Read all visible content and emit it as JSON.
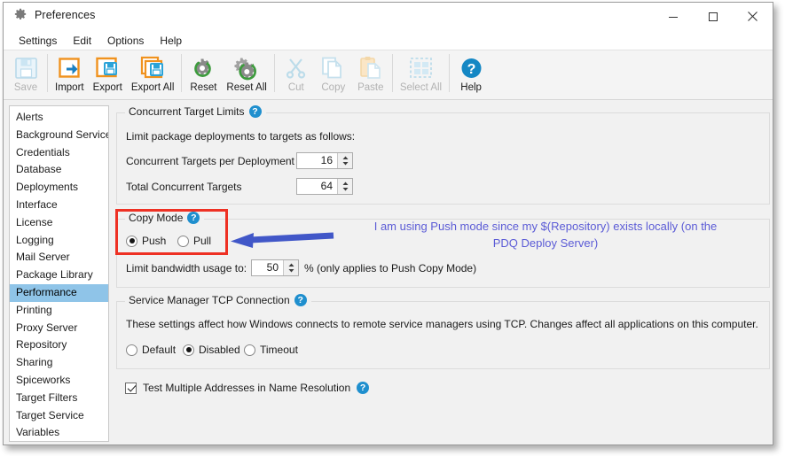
{
  "window": {
    "title": "Preferences",
    "icon": "gear-icon",
    "minimize_label": "–",
    "maximize_label": "❐",
    "close_label": "✕"
  },
  "menubar": {
    "items": [
      {
        "label": "Settings"
      },
      {
        "label": "Edit"
      },
      {
        "label": "Options"
      },
      {
        "label": "Help"
      }
    ]
  },
  "toolbar": {
    "buttons": [
      {
        "label": "Save",
        "icon": "save-floppy-icon",
        "disabled": true
      },
      {
        "label": "Import",
        "icon": "import-icon",
        "disabled": false
      },
      {
        "label": "Export",
        "icon": "export-icon",
        "disabled": false
      },
      {
        "label": "Export All",
        "icon": "export-all-icon",
        "disabled": false
      },
      {
        "label": "Reset",
        "icon": "reset-gear-icon",
        "disabled": false
      },
      {
        "label": "Reset All",
        "icon": "reset-all-gear-icon",
        "disabled": false
      },
      {
        "label": "Cut",
        "icon": "scissors-icon",
        "disabled": true
      },
      {
        "label": "Copy",
        "icon": "copy-pages-icon",
        "disabled": true
      },
      {
        "label": "Paste",
        "icon": "clipboard-paste-icon",
        "disabled": true
      },
      {
        "label": "Select All",
        "icon": "select-all-icon",
        "disabled": true
      },
      {
        "label": "Help",
        "icon": "help-circle-icon",
        "disabled": false
      }
    ]
  },
  "sidebar": {
    "selected": "Performance",
    "items": [
      {
        "label": "Alerts"
      },
      {
        "label": "Background Service"
      },
      {
        "label": "Credentials"
      },
      {
        "label": "Database"
      },
      {
        "label": "Deployments"
      },
      {
        "label": "Interface"
      },
      {
        "label": "License"
      },
      {
        "label": "Logging"
      },
      {
        "label": "Mail Server"
      },
      {
        "label": "Package Library"
      },
      {
        "label": "Performance"
      },
      {
        "label": "Printing"
      },
      {
        "label": "Proxy Server"
      },
      {
        "label": "Repository"
      },
      {
        "label": "Sharing"
      },
      {
        "label": "Spiceworks"
      },
      {
        "label": "Target Filters"
      },
      {
        "label": "Target Service"
      },
      {
        "label": "Variables"
      }
    ]
  },
  "main": {
    "concurrent_target_limits": {
      "title": "Concurrent Target Limits",
      "help_glyph": "?",
      "description": "Limit package deployments to targets as follows:",
      "fields": [
        {
          "label": "Concurrent Targets per Deployment",
          "value": "16"
        },
        {
          "label": "Total Concurrent Targets",
          "value": "64"
        }
      ]
    },
    "copy_mode": {
      "title": "Copy Mode",
      "help_glyph": "?",
      "options": [
        {
          "label": "Push",
          "selected": true
        },
        {
          "label": "Pull",
          "selected": false
        }
      ],
      "bandwidth_label": "Limit bandwidth usage to:",
      "bandwidth_value": "50",
      "bandwidth_suffix": "% (only applies to Push Copy Mode)"
    },
    "service_manager": {
      "title": "Service Manager TCP Connection",
      "help_glyph": "?",
      "description": "These settings affect how Windows connects to remote service managers using TCP. Changes affect all applications on this computer.",
      "options": [
        {
          "label": "Default",
          "selected": false
        },
        {
          "label": "Disabled",
          "selected": true
        },
        {
          "label": "Timeout",
          "selected": false
        }
      ]
    },
    "name_resolution": {
      "label": "Test Multiple Addresses in Name Resolution",
      "checked": true,
      "help_glyph": "?"
    }
  },
  "annotation": {
    "line1": "I am using Push mode since my $(Repository) exists locally (on the",
    "line2": "PDQ Deploy Server)",
    "text_color": "#5b5bd6",
    "arrow_color": "#4157c8",
    "highlight_color": "#ee3124"
  }
}
